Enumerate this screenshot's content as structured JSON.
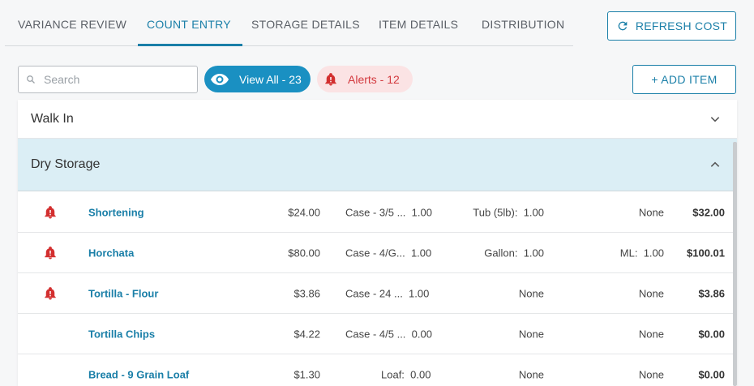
{
  "tabs": [
    {
      "label": "VARIANCE REVIEW",
      "active": false
    },
    {
      "label": "COUNT ENTRY",
      "active": true
    },
    {
      "label": "STORAGE DETAILS",
      "active": false
    },
    {
      "label": "ITEM DETAILS",
      "active": false
    },
    {
      "label": "DISTRIBUTION",
      "active": false
    }
  ],
  "refresh_button": {
    "label": "REFRESH COST",
    "icon": "refresh-icon"
  },
  "search": {
    "placeholder": "Search",
    "value": "",
    "icon": "search-icon"
  },
  "filters": {
    "view_all": {
      "label": "View All - 23",
      "icon": "eye-icon"
    },
    "alerts": {
      "label": "Alerts - 12",
      "icon": "bell-alert-icon"
    }
  },
  "add_item_button": {
    "label": "+ ADD ITEM"
  },
  "groups": [
    {
      "name": "Walk In",
      "expanded": false,
      "icon": "chevron-down-icon"
    },
    {
      "name": "Dry Storage",
      "expanded": true,
      "icon": "chevron-up-icon"
    }
  ],
  "items": [
    {
      "alert": true,
      "name": "Shortening",
      "price": "$24.00",
      "unit1": "Case - 3/5 ...",
      "unit1_qty": "1.00",
      "unit2": "Tub (5lb):",
      "unit2_qty": "1.00",
      "unit3": "None",
      "unit3_qty": "",
      "total": "$32.00"
    },
    {
      "alert": true,
      "name": "Horchata",
      "price": "$80.00",
      "unit1": "Case - 4/G...",
      "unit1_qty": "1.00",
      "unit2": "Gallon:",
      "unit2_qty": "1.00",
      "unit3": "ML:",
      "unit3_qty": "1.00",
      "total": "$100.01"
    },
    {
      "alert": true,
      "name": "Tortilla - Flour",
      "price": "$3.86",
      "unit1": "Case - 24 ...",
      "unit1_qty": "1.00",
      "unit2": "None",
      "unit2_qty": "",
      "unit3": "None",
      "unit3_qty": "",
      "total": "$3.86"
    },
    {
      "alert": false,
      "name": "Tortilla Chips",
      "price": "$4.22",
      "unit1": "Case - 4/5 ...",
      "unit1_qty": "0.00",
      "unit2": "None",
      "unit2_qty": "",
      "unit3": "None",
      "unit3_qty": "",
      "total": "$0.00"
    },
    {
      "alert": false,
      "name": "Bread - 9 Grain Loaf",
      "price": "$1.30",
      "unit1": "Loaf:",
      "unit1_qty": "0.00",
      "unit2": "None",
      "unit2_qty": "",
      "unit3": "None",
      "unit3_qty": "",
      "total": "$0.00"
    }
  ],
  "colors": {
    "accent": "#1a7fa8",
    "alert": "#d32f2f",
    "group_highlight": "#dbeef5"
  }
}
